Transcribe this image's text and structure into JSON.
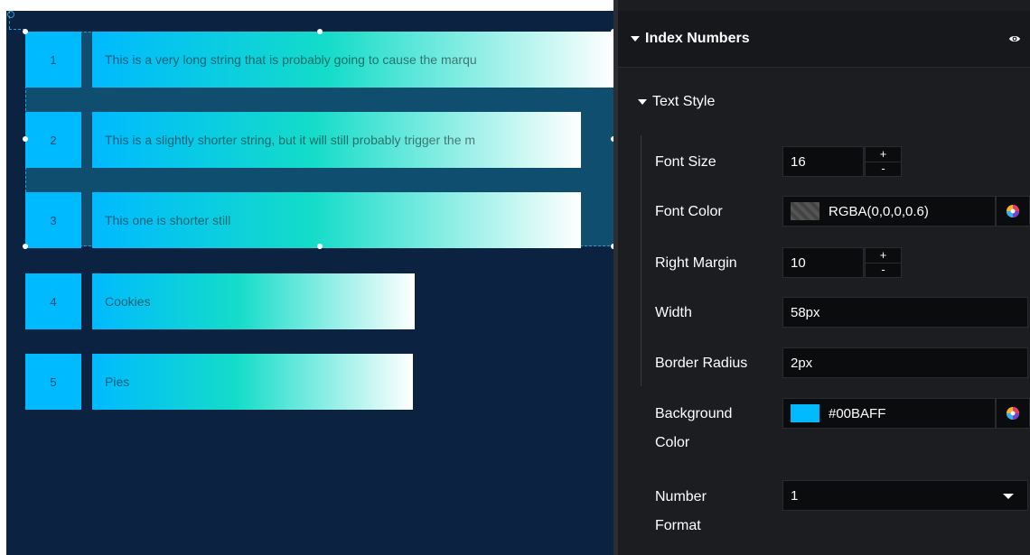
{
  "canvas": {
    "rows": [
      {
        "index": "1",
        "text": "This is a very long string that is probably going to cause the marqu"
      },
      {
        "index": "2",
        "text": "This is a slightly shorter string, but it will still probably trigger the m"
      },
      {
        "index": "3",
        "text": "This one is shorter still"
      },
      {
        "index": "4",
        "text": "Cookies"
      },
      {
        "index": "5",
        "text": "Pies"
      }
    ],
    "colors": {
      "index_bg": "#00BAFF",
      "bar_gradient_start": "#00BAFF",
      "bar_gradient_mid": "#14DCC9",
      "bar_gradient_end": "#FFFFFF",
      "canvas_bg": "#0B2340",
      "selection_bg": "#0F4E6E"
    }
  },
  "panel": {
    "header": {
      "title": "Index Numbers",
      "visibility_icon": "eye-icon"
    },
    "section": {
      "title": "Text Style"
    },
    "properties": {
      "font_size": {
        "label": "Font Size",
        "value": "16",
        "increment": "+",
        "decrement": "-"
      },
      "font_color": {
        "label": "Font Color",
        "value": "RGBA(0,0,0,0.6)",
        "swatch": "rgba(0,0,0,0.6)"
      },
      "right_margin": {
        "label": "Right Margin",
        "value": "10",
        "increment": "+",
        "decrement": "-"
      },
      "width": {
        "label": "Width",
        "value": "58px"
      },
      "border_radius": {
        "label": "Border Radius",
        "value": "2px"
      },
      "background_color": {
        "label_line1": "Background",
        "label_line2": "Color",
        "value": "#00BAFF",
        "swatch": "#00BAFF"
      },
      "number_format": {
        "label_line1": "Number",
        "label_line2": "Format",
        "value": "1"
      }
    }
  }
}
